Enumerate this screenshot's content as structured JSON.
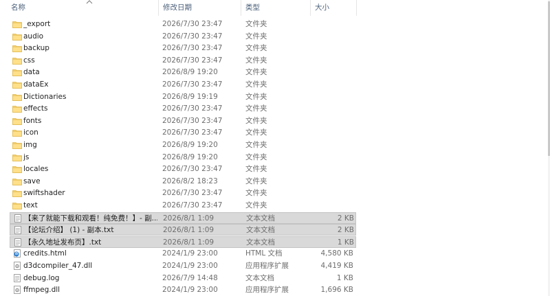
{
  "header": {
    "name": "名称",
    "date": "修改日期",
    "type": "类型",
    "size": "大小"
  },
  "files": [
    {
      "icon": "folder-icon",
      "name": "_export",
      "date": "2026/7/30 23:47",
      "type": "文件夹",
      "size": "",
      "selected": false
    },
    {
      "icon": "folder-icon",
      "name": "audio",
      "date": "2026/7/30 23:47",
      "type": "文件夹",
      "size": "",
      "selected": false
    },
    {
      "icon": "folder-icon",
      "name": "backup",
      "date": "2026/7/30 23:47",
      "type": "文件夹",
      "size": "",
      "selected": false
    },
    {
      "icon": "folder-icon",
      "name": "css",
      "date": "2026/7/30 23:47",
      "type": "文件夹",
      "size": "",
      "selected": false
    },
    {
      "icon": "folder-icon",
      "name": "data",
      "date": "2026/8/9 19:20",
      "type": "文件夹",
      "size": "",
      "selected": false
    },
    {
      "icon": "folder-icon",
      "name": "dataEx",
      "date": "2026/7/30 23:47",
      "type": "文件夹",
      "size": "",
      "selected": false
    },
    {
      "icon": "folder-icon",
      "name": "Dictionaries",
      "date": "2026/8/9 19:19",
      "type": "文件夹",
      "size": "",
      "selected": false
    },
    {
      "icon": "folder-icon",
      "name": "effects",
      "date": "2026/7/30 23:47",
      "type": "文件夹",
      "size": "",
      "selected": false
    },
    {
      "icon": "folder-icon",
      "name": "fonts",
      "date": "2026/7/30 23:47",
      "type": "文件夹",
      "size": "",
      "selected": false
    },
    {
      "icon": "folder-icon",
      "name": "icon",
      "date": "2026/7/30 23:47",
      "type": "文件夹",
      "size": "",
      "selected": false
    },
    {
      "icon": "folder-icon",
      "name": "img",
      "date": "2026/8/9 19:20",
      "type": "文件夹",
      "size": "",
      "selected": false
    },
    {
      "icon": "folder-icon",
      "name": "js",
      "date": "2026/8/9 19:20",
      "type": "文件夹",
      "size": "",
      "selected": false
    },
    {
      "icon": "folder-icon",
      "name": "locales",
      "date": "2026/7/30 23:47",
      "type": "文件夹",
      "size": "",
      "selected": false
    },
    {
      "icon": "folder-icon",
      "name": "save",
      "date": "2026/8/2 18:23",
      "type": "文件夹",
      "size": "",
      "selected": false
    },
    {
      "icon": "folder-icon",
      "name": "swiftshader",
      "date": "2026/7/30 23:47",
      "type": "文件夹",
      "size": "",
      "selected": false
    },
    {
      "icon": "folder-icon",
      "name": "text",
      "date": "2026/7/30 23:47",
      "type": "文件夹",
      "size": "",
      "selected": false
    },
    {
      "icon": "text-file-icon",
      "name": "【来了就能下载和观看！纯免费！】- 副...",
      "date": "2026/8/1 1:09",
      "type": "文本文档",
      "size": "2 KB",
      "selected": true
    },
    {
      "icon": "text-file-icon",
      "name": "【论坛介绍】 (1) - 副本.txt",
      "date": "2026/8/1 1:09",
      "type": "文本文档",
      "size": "2 KB",
      "selected": true
    },
    {
      "icon": "text-file-icon",
      "name": "【永久地址发布页】.txt",
      "date": "2026/8/1 1:09",
      "type": "文本文档",
      "size": "1 KB",
      "selected": true
    },
    {
      "icon": "html-file-icon",
      "name": "credits.html",
      "date": "2024/1/9 23:00",
      "type": "HTML 文档",
      "size": "4,580 KB",
      "selected": false
    },
    {
      "icon": "dll-file-icon",
      "name": "d3dcompiler_47.dll",
      "date": "2024/1/9 23:00",
      "type": "应用程序扩展",
      "size": "4,419 KB",
      "selected": false
    },
    {
      "icon": "text-file-icon",
      "name": "debug.log",
      "date": "2026/7/9 14:48",
      "type": "文本文档",
      "size": "1 KB",
      "selected": false
    },
    {
      "icon": "dll-file-icon",
      "name": "ffmpeg.dll",
      "date": "2024/1/9 23:00",
      "type": "应用程序扩展",
      "size": "1,696 KB",
      "selected": false
    }
  ]
}
